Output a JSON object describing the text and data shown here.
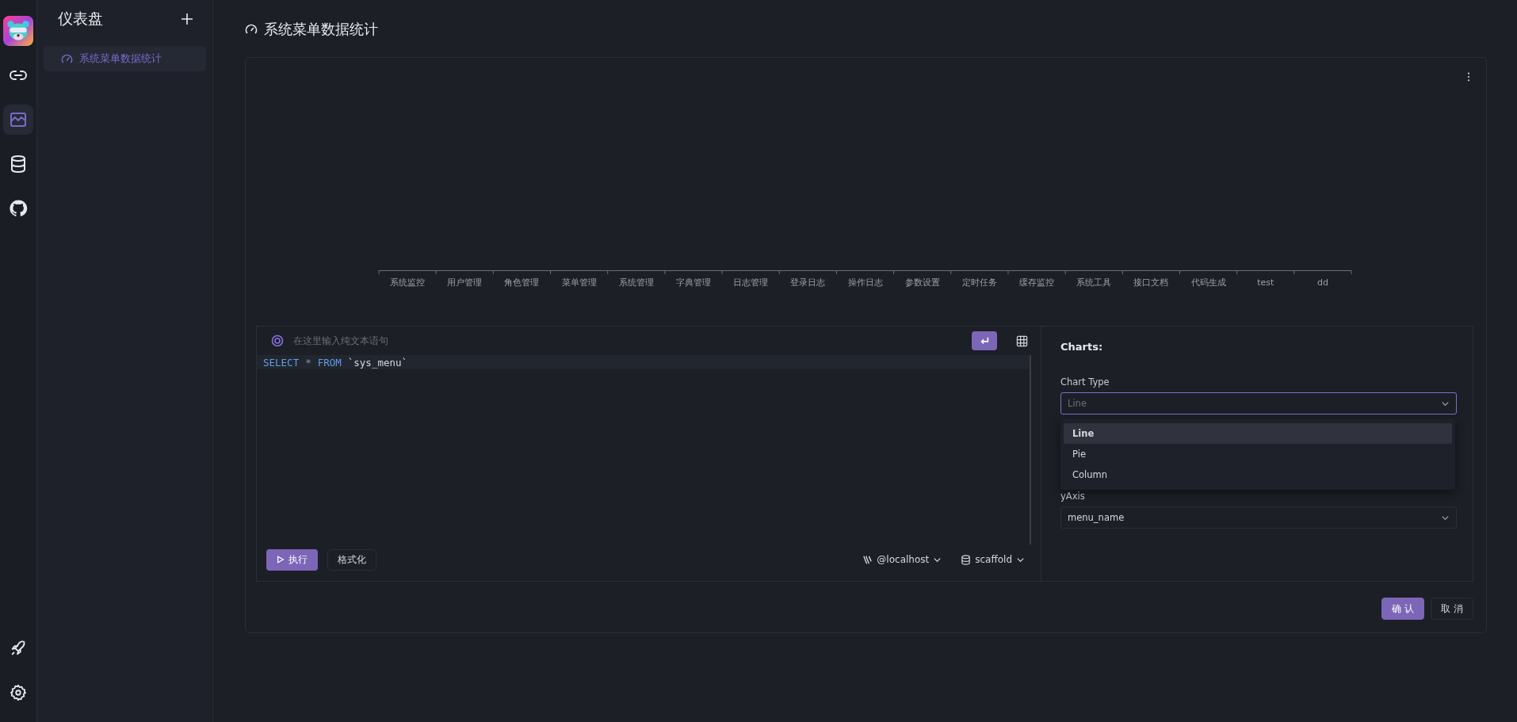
{
  "rail": {
    "items": [
      {
        "kind": "link",
        "selected": false
      },
      {
        "kind": "chart",
        "selected": true
      },
      {
        "kind": "database",
        "selected": false
      },
      {
        "kind": "github",
        "selected": false
      }
    ],
    "bottom_items": [
      {
        "kind": "rocket",
        "selected": false
      },
      {
        "kind": "settings",
        "selected": false
      }
    ]
  },
  "sidebar": {
    "title": "仪表盘",
    "items": [
      {
        "label": "系统菜单数据统计",
        "selected": true
      }
    ]
  },
  "page": {
    "title": "系统菜单数据统计"
  },
  "chart": {
    "axis_labels": [
      "系统监控",
      "用户管理",
      "角色管理",
      "菜单管理",
      "系统管理",
      "字典管理",
      "日志管理",
      "登录日志",
      "操作日志",
      "参数设置",
      "定时任务",
      "缓存监控",
      "系统工具",
      "接口文档",
      "代码生成",
      "test",
      "dd"
    ]
  },
  "editor": {
    "placeholder": "在这里输入纯文本语句",
    "sql": [
      {
        "kind": "keyword",
        "text": "SELECT"
      },
      {
        "kind": "operator",
        "text": "*"
      },
      {
        "kind": "keyword",
        "text": "FROM"
      },
      {
        "kind": "identifier",
        "text": "`sys_menu`"
      }
    ],
    "run_button": "执行",
    "format_button": "格式化",
    "connection": "@localhost",
    "database": "scaffold"
  },
  "charts_panel": {
    "title": "Charts:",
    "chart_type": {
      "label": "Chart Type",
      "placeholder": "Line",
      "expanded": true,
      "options": [
        {
          "label": "Line",
          "selected": true
        },
        {
          "label": "Pie",
          "selected": false
        },
        {
          "label": "Column",
          "selected": false
        }
      ]
    },
    "y_axis": {
      "label": "yAxis",
      "value": "menu_name"
    }
  },
  "buttons": [
    {
      "label": "确 认",
      "kind": "primary"
    },
    {
      "label": "取 消",
      "kind": "default"
    }
  ]
}
